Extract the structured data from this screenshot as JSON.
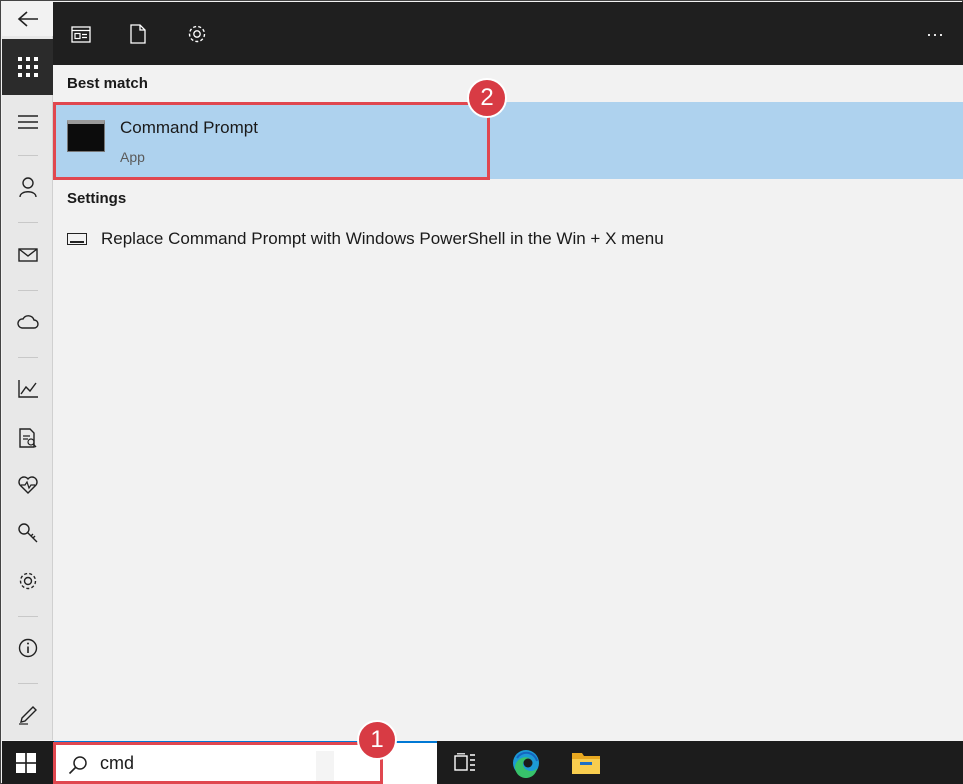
{
  "toolbar": {
    "icons": [
      "apps-icon",
      "document-icon",
      "settings-icon"
    ],
    "more_label": "···"
  },
  "results": {
    "best_match_header": "Best match",
    "best_match": {
      "title": "Command Prompt",
      "subtitle": "App"
    },
    "settings_header": "Settings",
    "settings_items": [
      {
        "label": "Replace Command Prompt with Windows PowerShell in the Win + X menu"
      }
    ]
  },
  "search": {
    "value": "cmd"
  },
  "annotations": {
    "badge_1": "1",
    "badge_2": "2",
    "color": "#e0474f"
  },
  "rail": {
    "items": [
      "back-icon",
      "apps-icon",
      "menu-icon",
      "person-icon",
      "mail-icon",
      "cloud-icon",
      "chart-icon",
      "report-icon",
      "health-icon",
      "key-icon",
      "settings-icon",
      "info-icon",
      "pen-icon"
    ]
  },
  "colors": {
    "selection": "#aed2ee",
    "toolbar": "#1f1f1f",
    "taskbar": "#1c1c1c",
    "accent": "#0078d4"
  }
}
